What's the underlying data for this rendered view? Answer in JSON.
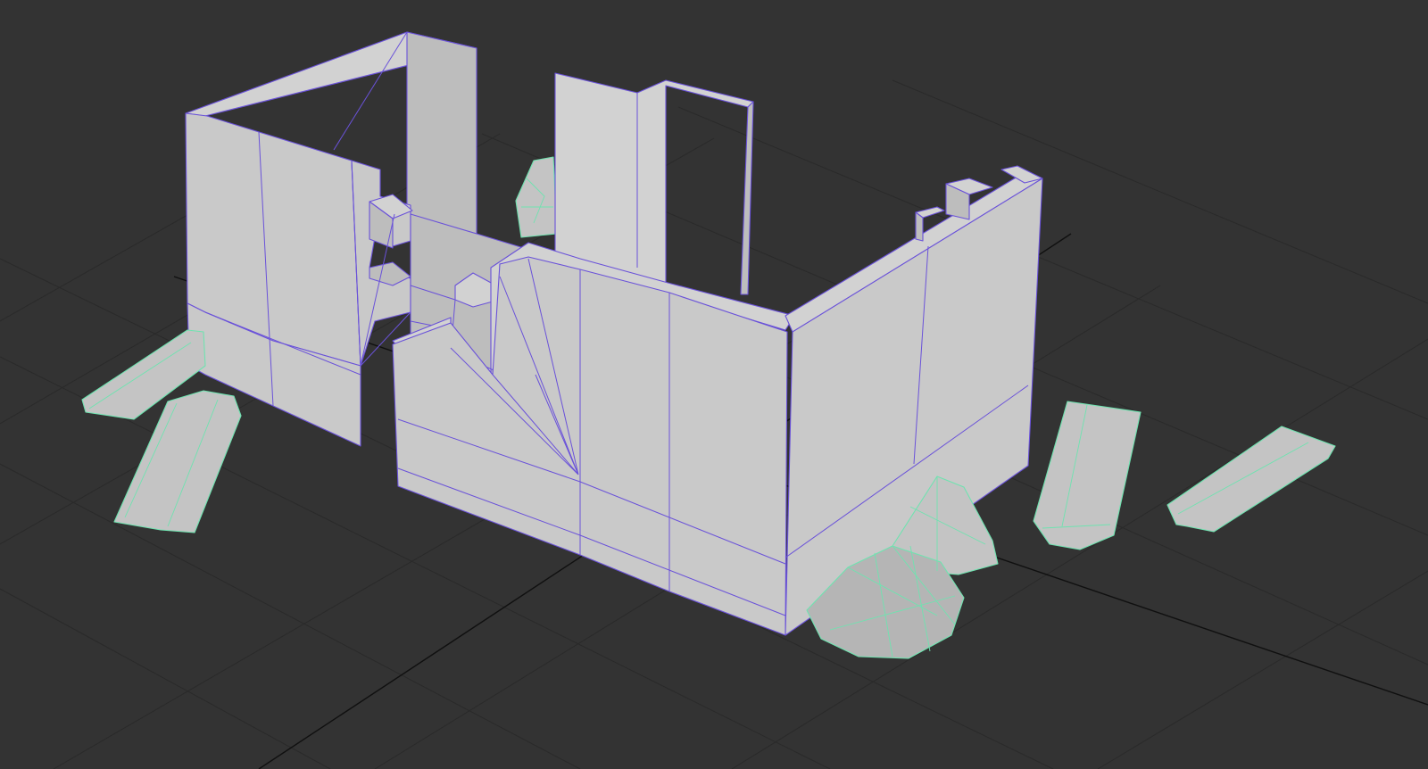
{
  "viewport": {
    "background_color": "#333333",
    "grid_color": "#2a2a2a",
    "axis_color": "#101010"
  },
  "objects": {
    "building": {
      "face_color": "#c9c9c9",
      "wireframe_color": "#6a52d9",
      "selected": false
    },
    "rubble": {
      "face_color": "#c4c4c4",
      "wireframe_color": "#6fe3b0",
      "selected": true,
      "pieces": [
        "plank",
        "plank",
        "plank",
        "plank",
        "boulder"
      ]
    }
  }
}
